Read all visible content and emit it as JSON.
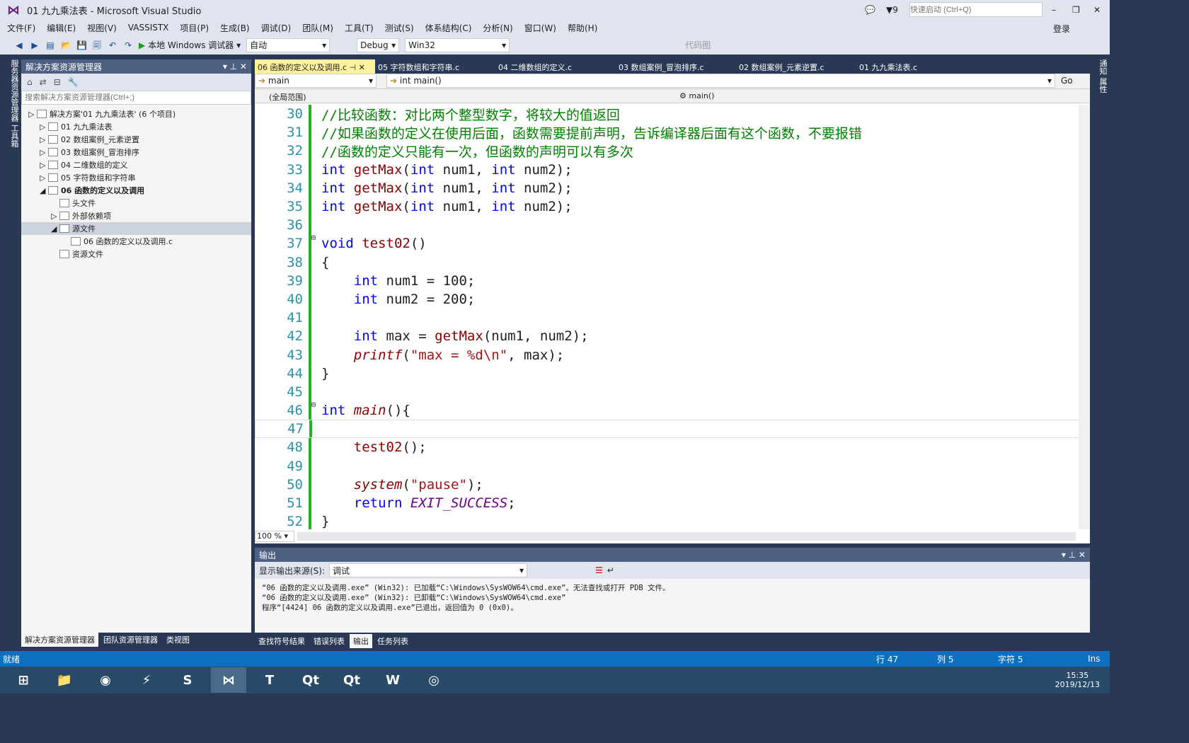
{
  "window": {
    "title": "01 九九乘法表 - Microsoft Visual Studio",
    "notif_count": "9",
    "quick_launch_placeholder": "快速启动 (Ctrl+Q)",
    "login": "登录"
  },
  "menu": [
    "文件(F)",
    "编辑(E)",
    "视图(V)",
    "VASSISTX",
    "项目(P)",
    "生成(B)",
    "调试(D)",
    "团队(M)",
    "工具(T)",
    "测试(S)",
    "体系结构(C)",
    "分析(N)",
    "窗口(W)",
    "帮助(H)"
  ],
  "toolbar": {
    "debugger": "本地 Windows 调试器",
    "config_auto": "自动",
    "build_config": "Debug",
    "platform": "Win32",
    "code_map": "代码图"
  },
  "left_strip": "服务器资源管理器  工具箱",
  "right_strip": "通知  属性",
  "solution": {
    "title": "解决方案资源管理器",
    "search_placeholder": "搜索解决方案资源管理器(Ctrl+;)",
    "items": [
      {
        "label": "解决方案'01 九九乘法表' (6 个项目)",
        "level": 0
      },
      {
        "label": "01 九九乘法表",
        "level": 1
      },
      {
        "label": "02 数组案例_元素逆置",
        "level": 1
      },
      {
        "label": "03 数组案例_冒泡排序",
        "level": 1
      },
      {
        "label": "04 二维数组的定义",
        "level": 1
      },
      {
        "label": "05 字符数组和字符串",
        "level": 1
      },
      {
        "label": "06 函数的定义以及调用",
        "level": 1,
        "bold": true
      },
      {
        "label": "头文件",
        "level": 2
      },
      {
        "label": "外部依赖项",
        "level": 2
      },
      {
        "label": "源文件",
        "level": 2,
        "selected": true
      },
      {
        "label": "06 函数的定义以及调用.c",
        "level": 3
      },
      {
        "label": "资源文件",
        "level": 2
      }
    ],
    "bottom_tabs": [
      "解决方案资源管理器",
      "团队资源管理器",
      "类视图"
    ]
  },
  "editor": {
    "tabs": [
      "06 函数的定义以及调用.c",
      "05 字符数组和字符串.c",
      "04 二维数组的定义.c",
      "03 数组案例_冒泡排序.c",
      "02 数组案例_元素逆置.c",
      "01 九九乘法表.c"
    ],
    "nav_left": "main",
    "nav_right": "int main()",
    "go": "Go",
    "scope": "(全局范围)",
    "scope_fn": "main()",
    "zoom": "100 %",
    "lines": [
      {
        "n": "30",
        "html": "<span class='cm'>//比较函数：对比两个整型数字，将较大的值返回</span>"
      },
      {
        "n": "31",
        "html": "<span class='cm'>//如果函数的定义在使用后面，函数需要提前声明，告诉编译器后面有这个函数，不要报错</span>"
      },
      {
        "n": "32",
        "html": "<span class='cm'>//函数的定义只能有一次，但函数的声明可以有多次</span>"
      },
      {
        "n": "33",
        "html": "<span class='kw'>int</span> <span class='fn'>getMax</span>(<span class='kw'>int</span> num1, <span class='kw'>int</span> num2);"
      },
      {
        "n": "34",
        "html": "<span class='kw'>int</span> <span class='fn'>getMax</span>(<span class='kw'>int</span> num1, <span class='kw'>int</span> num2);"
      },
      {
        "n": "35",
        "html": "<span class='kw'>int</span> <span class='fn'>getMax</span>(<span class='kw'>int</span> num1, <span class='kw'>int</span> num2);"
      },
      {
        "n": "36",
        "html": ""
      },
      {
        "n": "37",
        "html": "<span class='kw'>void</span> <span class='fn'>test02</span>()"
      },
      {
        "n": "38",
        "html": "{"
      },
      {
        "n": "39",
        "html": "    <span class='kw'>int</span> num1 = 100;"
      },
      {
        "n": "40",
        "html": "    <span class='kw'>int</span> num2 = 200;"
      },
      {
        "n": "41",
        "html": ""
      },
      {
        "n": "42",
        "html": "    <span class='kw'>int</span> max = <span class='fn'>getMax</span>(num1, num2);"
      },
      {
        "n": "43",
        "html": "    <span class='it'>printf</span>(<span class='str'>\"max = %d\\n\"</span>, max);"
      },
      {
        "n": "44",
        "html": "}"
      },
      {
        "n": "45",
        "html": ""
      },
      {
        "n": "46",
        "html": "<span class='kw'>int</span> <span class='it'>main</span>(){"
      },
      {
        "n": "47",
        "html": ""
      },
      {
        "n": "48",
        "html": "    <span class='fn'>test02</span>();"
      },
      {
        "n": "49",
        "html": ""
      },
      {
        "n": "50",
        "html": "    <span class='it'>system</span>(<span class='str'>\"pause\"</span>);"
      },
      {
        "n": "51",
        "html": "    <span class='kw'>return</span> <span class='mac'>EXIT_SUCCESS</span>;"
      },
      {
        "n": "52",
        "html": "}"
      }
    ]
  },
  "output": {
    "title": "输出",
    "source_label": "显示输出来源(S):",
    "source_value": "调试",
    "lines": [
      "“06 函数的定义以及调用.exe” (Win32):  已加载“C:\\Windows\\SysWOW64\\cmd.exe”。无法查找或打开 PDB 文件。",
      "“06 函数的定义以及调用.exe” (Win32):  已卸载“C:\\Windows\\SysWOW64\\cmd.exe”",
      "程序“[4424] 06 函数的定义以及调用.exe”已退出，返回值为 0 (0x0)。"
    ],
    "bottom_tabs": [
      "查找符号结果",
      "错误列表",
      "输出",
      "任务列表"
    ],
    "active_tab": "输出"
  },
  "status": {
    "ready": "就绪",
    "row": "行 47",
    "col": "列 5",
    "char": "字符 5",
    "mode": "Ins"
  },
  "taskbar": {
    "apps": [
      "Windows",
      "文件资源管理器",
      "Chrome",
      "迅雷",
      "Sublime",
      "Visual Studio",
      "Typora",
      "Qt",
      "Qt Creator",
      "Word",
      "远程桌面"
    ],
    "time": "15:35",
    "date": "2019/12/13"
  },
  "colors": {
    "status_bar": "#0e70c0",
    "chrome": "#293955",
    "active_tab": "#fff29d",
    "change_bar": "#1cb81c"
  }
}
